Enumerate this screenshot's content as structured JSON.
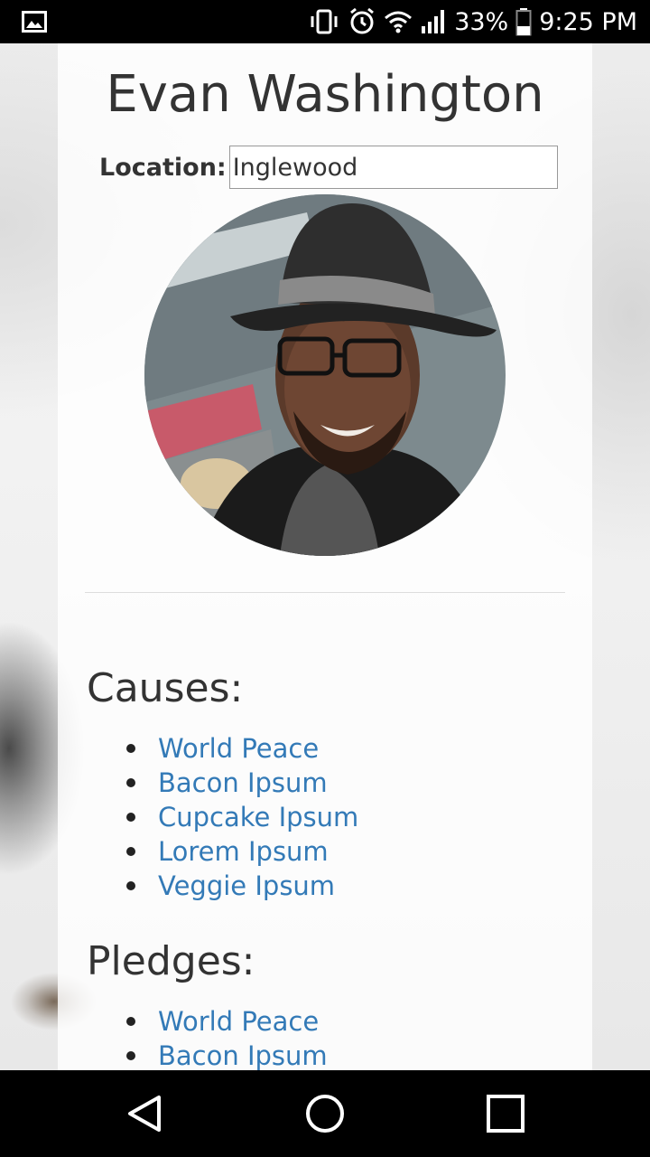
{
  "status_bar": {
    "battery": "33%",
    "time": "9:25 PM",
    "icons": [
      "image-icon",
      "vibrate-icon",
      "alarm-icon",
      "wifi-icon",
      "signal-icon",
      "battery-icon"
    ]
  },
  "profile": {
    "name": "Evan Washington",
    "location_label": "Location:",
    "location_value": "Inglewood"
  },
  "causes": {
    "title": "Causes:",
    "items": [
      "World Peace",
      "Bacon Ipsum",
      "Cupcake Ipsum",
      "Lorem Ipsum",
      "Veggie Ipsum"
    ]
  },
  "pledges": {
    "title": "Pledges:",
    "items": [
      "World Peace",
      "Bacon Ipsum"
    ]
  },
  "nav": {
    "icons": [
      "back-icon",
      "home-icon",
      "recents-icon"
    ]
  },
  "colors": {
    "link": "#337ab7",
    "text": "#333333"
  }
}
